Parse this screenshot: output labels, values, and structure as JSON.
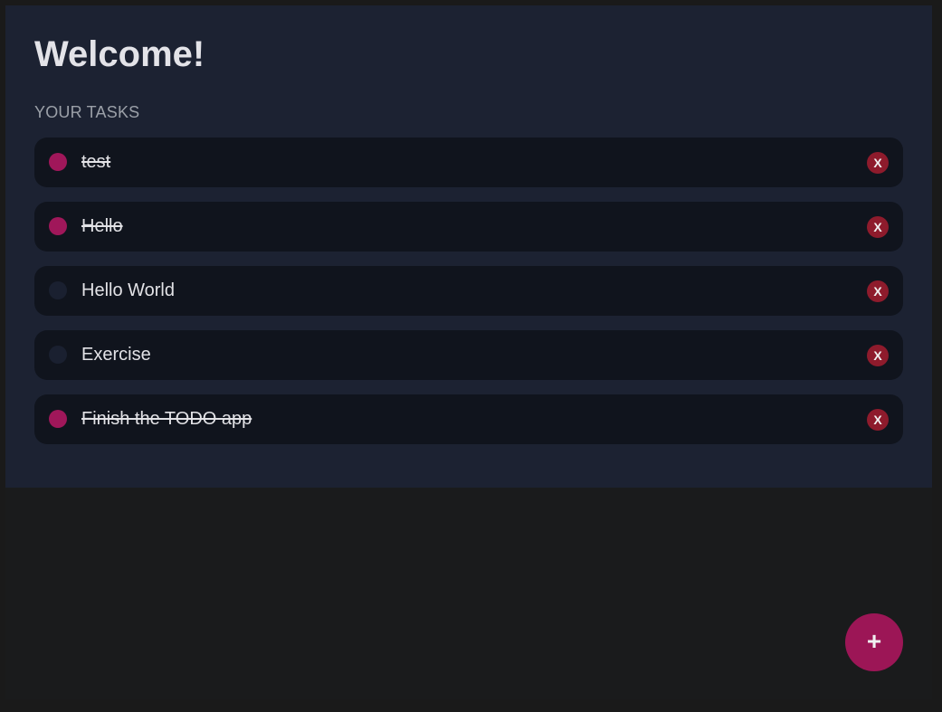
{
  "header": {
    "title": "Welcome!"
  },
  "tasks_section": {
    "label": "YOUR TASKS",
    "items": [
      {
        "label": "test",
        "completed": true,
        "delete_label": "X"
      },
      {
        "label": "Hello",
        "completed": true,
        "delete_label": "X"
      },
      {
        "label": "Hello World",
        "completed": false,
        "delete_label": "X"
      },
      {
        "label": "Exercise",
        "completed": false,
        "delete_label": "X"
      },
      {
        "label": "Finish the TODO app",
        "completed": true,
        "delete_label": "X"
      }
    ]
  },
  "add_button": {
    "label": "+"
  },
  "colors": {
    "accent": "#a0175a",
    "delete": "#8e1b2c",
    "panel": "#1c2232",
    "task_background": "#10141d",
    "page_background": "#1a1a1a"
  },
  "icons": {
    "check": "circle-check-icon",
    "delete": "x-icon",
    "add": "plus-icon"
  }
}
